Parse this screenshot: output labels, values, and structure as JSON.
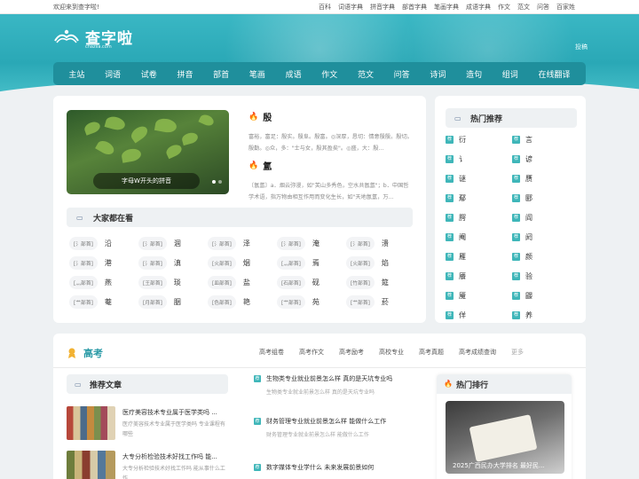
{
  "topbar": {
    "welcome": "欢迎来到查字啦!",
    "links": [
      "百科",
      "词语字典",
      "拼音字典",
      "部首字典",
      "笔画字典",
      "成语字典",
      "作文",
      "范文",
      "问答",
      "百家姓"
    ]
  },
  "logo": {
    "name": "查字啦",
    "sub": "chazila.com"
  },
  "post_link": "投稿",
  "nav": [
    "主站",
    "词语",
    "试卷",
    "拼音",
    "部首",
    "笔画",
    "成语",
    "作文",
    "范文",
    "问答",
    "诗词",
    "造句",
    "组词",
    "在线翻译"
  ],
  "slider": {
    "caption": "字母W开头的拼音"
  },
  "entries": [
    {
      "word": "殷",
      "desc": "富裕，富足：殷实。殷阜。殷富。◎深厚，恳切：情意殷殷。殷切。殷勤。◎众，多：\"士与女，殷其盈矣\"。◎盛，大：殷..."
    },
    {
      "word": "氲",
      "desc": "〔氤氲〕a．烟云弥漫，如\"芙山多秀色，空水共氤氲\"；b．中国哲学术语，指万物由相互作用而变化生长，如\"天地氤氲，万..."
    }
  ],
  "reading": {
    "title": "大家都在看",
    "items": [
      {
        "tag": "[氵部首]",
        "ch": "沿"
      },
      {
        "tag": "[氵部首]",
        "ch": "涸"
      },
      {
        "tag": "[氵部首]",
        "ch": "泽"
      },
      {
        "tag": "[氵部首]",
        "ch": "淹"
      },
      {
        "tag": "[氵部首]",
        "ch": "溃"
      },
      {
        "tag": "[氵部首]",
        "ch": "港"
      },
      {
        "tag": "[氵部首]",
        "ch": "滇"
      },
      {
        "tag": "[火部首]",
        "ch": "烟"
      },
      {
        "tag": "[灬部首]",
        "ch": "焉"
      },
      {
        "tag": "[火部首]",
        "ch": "焰"
      },
      {
        "tag": "[灬部首]",
        "ch": "燕"
      },
      {
        "tag": "[王部首]",
        "ch": "琰"
      },
      {
        "tag": "[皿部首]",
        "ch": "盐"
      },
      {
        "tag": "[石部首]",
        "ch": "砚"
      },
      {
        "tag": "[竹部首]",
        "ch": "筵"
      },
      {
        "tag": "[艹部首]",
        "ch": "菴"
      },
      {
        "tag": "[月部首]",
        "ch": "胭"
      },
      {
        "tag": "[色部首]",
        "ch": "艳"
      },
      {
        "tag": "[艹部首]",
        "ch": "苑"
      },
      {
        "tag": "[艹部首]",
        "ch": "菸"
      }
    ]
  },
  "hot": {
    "title": "热门推荐",
    "badge": "荐",
    "items": [
      "衍",
      "言",
      "讠",
      "谚",
      "谜",
      "赝",
      "鄢",
      "郾",
      "腭",
      "阎",
      "阉",
      "阏",
      "雁",
      "颜",
      "餍",
      "验",
      "魇",
      "鼹",
      "佯",
      "养"
    ]
  },
  "gaokao": {
    "title": "高考",
    "tabs": [
      "高考组卷",
      "高考作文",
      "高考励考",
      "高校专业",
      "高考真题",
      "高考成绩查询"
    ],
    "more": "更多",
    "rec_title": "推荐文章",
    "articles": [
      {
        "title": "医疗美容技术专业属于医学类吗 ...",
        "desc": "医疗美容技术专业属于医学类吗 专业课程有哪些"
      },
      {
        "title": "大专分析检验技术好找工作吗 能...",
        "desc": "大专分析检验技术好找工作吗 能从事什么工作"
      }
    ],
    "news_badge": "荐",
    "news": [
      {
        "title": "生物类专业就业前景怎么样 真的是天坑专业吗",
        "sub": "生物类专业就业前景怎么样 真的是天坑专业吗"
      },
      {
        "title": "财务管理专业就业前景怎么样 能做什么工作",
        "sub": "财务管理专业就业前景怎么样 能做什么工作"
      },
      {
        "title": "数字媒体专业学什么 未来发展前景如何",
        "sub": ""
      }
    ],
    "rank_title": "热门排行",
    "rank_caption": "2025广西民办大学排名 最好民..."
  },
  "colors": {
    "teal": "#2aa8b6",
    "nav": "#1f8f9c",
    "badge": "#3fb6b9",
    "fire": "#e0452b"
  }
}
